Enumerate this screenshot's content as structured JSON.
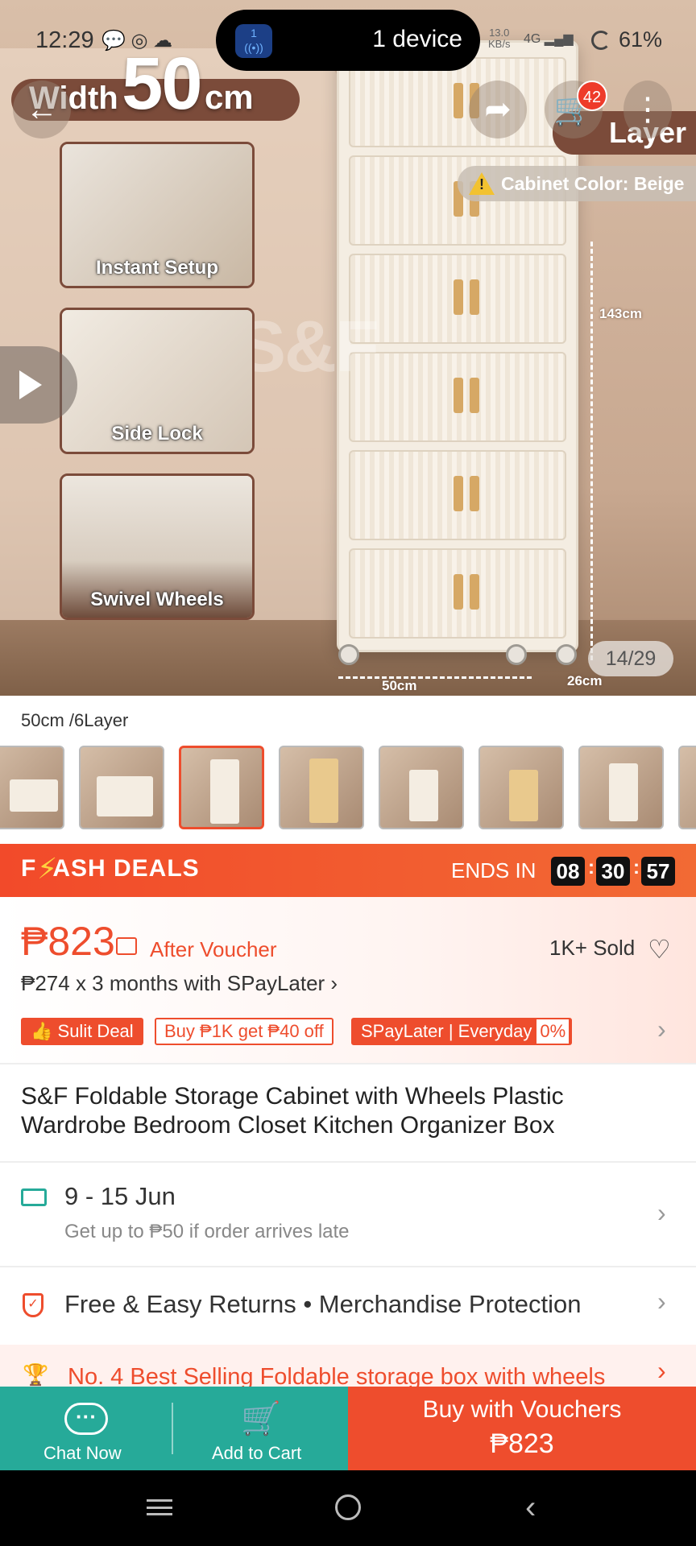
{
  "status_bar": {
    "time": "12:29",
    "notif_icons": "💬 ◎ ☁",
    "device_pill_icon": "((•))",
    "device_pill_badge": "1",
    "device_pill_label": "1 device",
    "net_speed_value": "13.0",
    "net_speed_unit": "KB/s",
    "network": "4G",
    "battery": "61%"
  },
  "hero": {
    "width_prefix": "Width",
    "width_value": "50",
    "width_unit": "cm",
    "layer_label": "Layer",
    "cabinet_color": "Cabinet Color: Beige",
    "height_dim": "143cm",
    "width_dim": "50cm",
    "depth_dim": "26cm",
    "watermark": "S&F",
    "features": [
      "Instant Setup",
      "Side Lock",
      "Swivel Wheels"
    ],
    "image_counter": "14/29",
    "cart_count": "42"
  },
  "variant": {
    "selected_label": "50cm /6Layer",
    "selected_index": 2
  },
  "flash_deals": {
    "title_f": "F",
    "title_rest": "ASH DEALS",
    "ends_in": "ENDS IN",
    "hours": "08",
    "minutes": "30",
    "seconds": "57"
  },
  "price": {
    "amount": "₱823",
    "after_voucher": "After Voucher",
    "sold": "1K+ Sold",
    "installment": "₱274 x 3 months with SPayLater ›",
    "tags": {
      "sulit": "Sulit Deal",
      "buy": "Buy ₱1K get ₱40 off",
      "spaylater": "SPayLater | Everyday",
      "spaylater_pct": "0%"
    }
  },
  "product": {
    "title": "S&F Foldable Storage Cabinet with Wheels Plastic Wardrobe Bedroom Closet Kitchen Organizer Box"
  },
  "shipping": {
    "date_range": "9 - 15 Jun",
    "late_note": "Get up to ₱50 if order arrives late"
  },
  "returns": {
    "text": "Free & Easy Returns  •  Merchandise Protection"
  },
  "best_selling": {
    "text": "No. 4 Best Selling Foldable storage box with wheels"
  },
  "bottom_bar": {
    "chat_label": "Chat Now",
    "cart_label": "Add to Cart",
    "buy_line1": "Buy with Vouchers",
    "buy_line2": "₱823"
  },
  "colors": {
    "accent": "#ee4d2d",
    "teal": "#26aa99"
  }
}
